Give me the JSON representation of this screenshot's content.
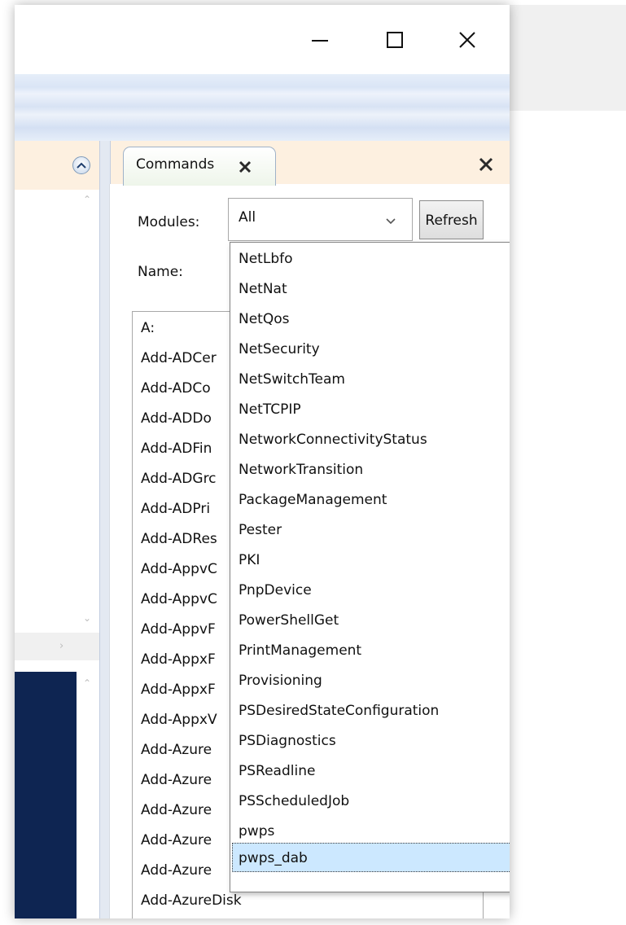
{
  "title_bar": {
    "minimize_icon": "minimize-icon",
    "maximize_icon": "maximize-icon",
    "close_icon": "close-icon"
  },
  "commands_pane": {
    "tab_label": "Commands",
    "modules_label": "Modules:",
    "modules_value": "All",
    "refresh_label": "Refresh",
    "name_label": "Name:",
    "command_list": [
      "A:",
      "Add-ADCer",
      "Add-ADCo",
      "Add-ADDo",
      "Add-ADFin",
      "Add-ADGrc",
      "Add-ADPri",
      "Add-ADRes",
      "Add-AppvC",
      "Add-AppvC",
      "Add-AppvF",
      "Add-AppxF",
      "Add-AppxF",
      "Add-AppxV",
      "Add-Azure",
      "Add-Azure",
      "Add-Azure",
      "Add-Azure",
      "Add-Azure",
      "Add-AzureDisk"
    ]
  },
  "module_dropdown": {
    "items": [
      "NetLbfo",
      "NetNat",
      "NetQos",
      "NetSecurity",
      "NetSwitchTeam",
      "NetTCPIP",
      "NetworkConnectivityStatus",
      "NetworkTransition",
      "PackageManagement",
      "Pester",
      "PKI",
      "PnpDevice",
      "PowerShellGet",
      "PrintManagement",
      "Provisioning",
      "PSDesiredStateConfiguration",
      "PSDiagnostics",
      "PSReadline",
      "PSScheduledJob",
      "pwps",
      "pwps_dab"
    ],
    "selected": "pwps_dab"
  },
  "colors": {
    "selection_bg": "#cce8ff",
    "console_bg": "#0e2552",
    "pane_header_bg": "#fdf0e0"
  }
}
